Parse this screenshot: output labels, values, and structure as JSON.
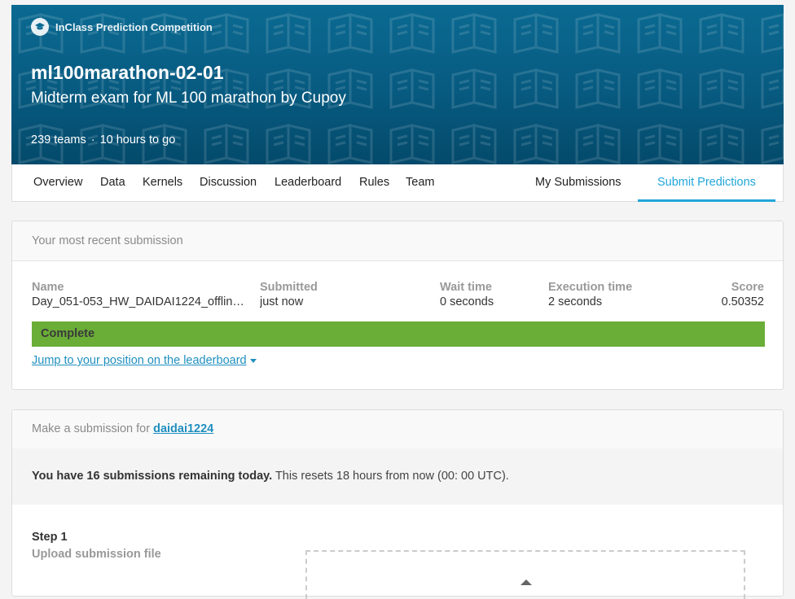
{
  "banner": {
    "competition_type": "InClass Prediction Competition",
    "title": "ml100marathon-02-01",
    "subtitle": "Midterm exam for ML 100 marathon by Cupoy",
    "teams": "239 teams",
    "separator": "·",
    "time_left": "10 hours to go",
    "colors": {
      "bg_top": "#0b6a92",
      "bg_bottom": "#044a6b"
    }
  },
  "nav": {
    "tabs": [
      "Overview",
      "Data",
      "Kernels",
      "Discussion",
      "Leaderboard",
      "Rules",
      "Team"
    ],
    "my_submissions": "My Submissions",
    "submit_predictions": "Submit Predictions",
    "active_color": "#20a6d9"
  },
  "recent": {
    "header": "Your most recent submission",
    "columns": {
      "name": {
        "label": "Name",
        "value": "Day_051-053_HW_DAIDAI1224_offline..."
      },
      "submitted": {
        "label": "Submitted",
        "value": "just now"
      },
      "wait": {
        "label": "Wait time",
        "value": "0 seconds"
      },
      "execution": {
        "label": "Execution time",
        "value": "2 seconds"
      },
      "score": {
        "label": "Score",
        "value": "0.50352"
      }
    },
    "status": "Complete",
    "status_color": "#6aad37",
    "jump_link": "Jump to your position on the leaderboard"
  },
  "make": {
    "header_prefix": "Make a submission for ",
    "user": "daidai1224",
    "remaining_bold": "You have 16 submissions remaining today.",
    "remaining_rest": " This resets 18 hours from now (00: 00 UTC).",
    "step_num": "Step 1",
    "step_desc": "Upload submission file"
  }
}
